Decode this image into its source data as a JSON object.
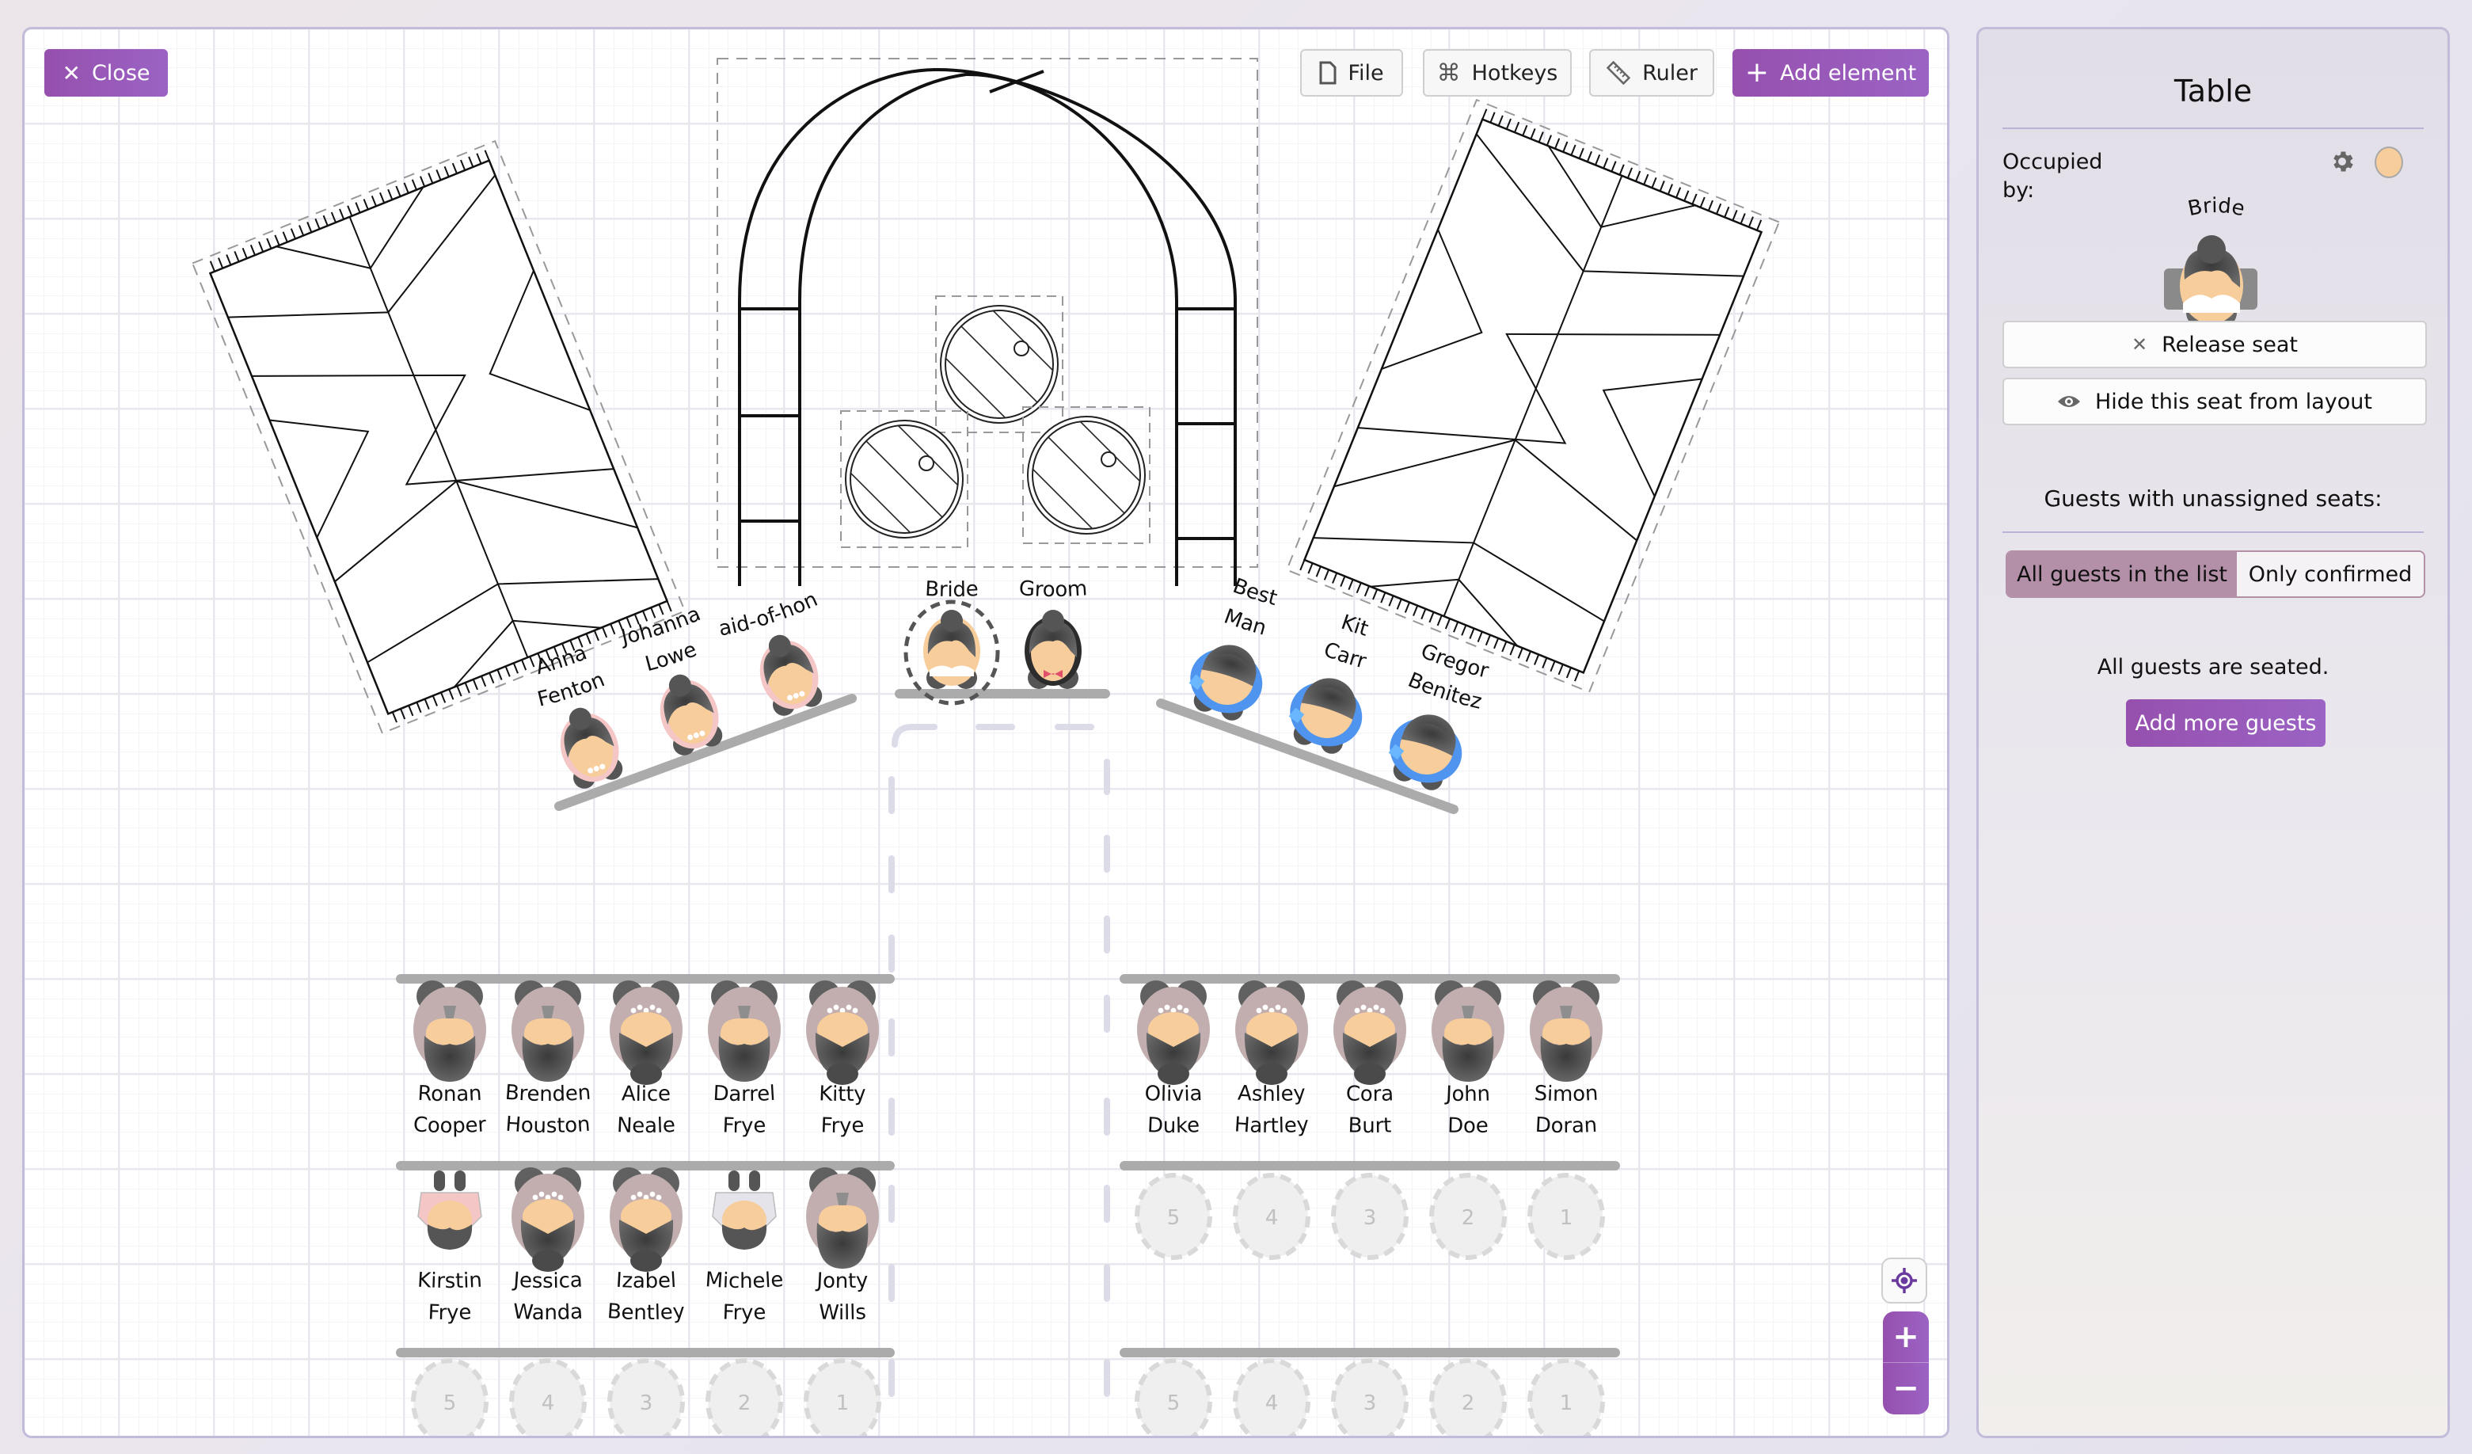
{
  "toolbar": {
    "close_label": "Close",
    "file_label": "File",
    "hotkeys_label": "Hotkeys",
    "ruler_label": "Ruler",
    "add_element_label": "Add element"
  },
  "colors": {
    "accent": "#9650ae",
    "bride_skin": "#f7cd9c",
    "bridesmaid": "#f4c6c6",
    "groomsman": "#4f95f0",
    "guest_body": "#c2aeae",
    "table_bar": "#ababab"
  },
  "layout_elements": {
    "arch": "Arch",
    "barrels": [
      "Barrel",
      "Barrel",
      "Barrel"
    ],
    "rugs": [
      "Rug",
      "Rug"
    ]
  },
  "head_table": {
    "left": [
      {
        "first": "Anna",
        "last": "Fenton",
        "type": "bridesmaid"
      },
      {
        "first": "Johanna",
        "last": "Lowe",
        "type": "bridesmaid"
      },
      {
        "first": "Maid-of-honor",
        "last": "",
        "type": "bridesmaid"
      }
    ],
    "center": [
      {
        "first": "Bride",
        "last": "",
        "type": "bride",
        "selected": true
      },
      {
        "first": "Groom",
        "last": "",
        "type": "groom"
      }
    ],
    "right": [
      {
        "first": "Best",
        "last": "Man",
        "type": "groomsman"
      },
      {
        "first": "Kit",
        "last": "Carr",
        "type": "groomsman"
      },
      {
        "first": "Gregor",
        "last": "Benitez",
        "type": "groomsman"
      }
    ]
  },
  "rows": {
    "left": [
      [
        {
          "first": "Ronan",
          "last": "Cooper",
          "type": "man"
        },
        {
          "first": "Brenden",
          "last": "Houston",
          "type": "man"
        },
        {
          "first": "Alice",
          "last": "Neale",
          "type": "woman"
        },
        {
          "first": "Darrel",
          "last": "Frye",
          "type": "man"
        },
        {
          "first": "Kitty",
          "last": "Frye",
          "type": "woman"
        }
      ],
      [
        {
          "first": "Kirstin",
          "last": "Frye",
          "type": "girl"
        },
        {
          "first": "Jessica",
          "last": "Wanda",
          "type": "woman"
        },
        {
          "first": "Izabel",
          "last": "Bentley",
          "type": "woman"
        },
        {
          "first": "Michele",
          "last": "Frye",
          "type": "boy"
        },
        {
          "first": "Jonty",
          "last": "Wills",
          "type": "man"
        }
      ],
      [
        {
          "empty": "5"
        },
        {
          "empty": "4"
        },
        {
          "empty": "3"
        },
        {
          "empty": "2"
        },
        {
          "empty": "1"
        }
      ]
    ],
    "right": [
      [
        {
          "first": "Olivia",
          "last": "Duke",
          "type": "woman"
        },
        {
          "first": "Ashley",
          "last": "Hartley",
          "type": "woman"
        },
        {
          "first": "Cora",
          "last": "Burt",
          "type": "woman"
        },
        {
          "first": "John",
          "last": "Doe",
          "type": "man"
        },
        {
          "first": "Simon",
          "last": "Doran",
          "type": "man"
        }
      ],
      [
        {
          "empty": "5"
        },
        {
          "empty": "4"
        },
        {
          "empty": "3"
        },
        {
          "empty": "2"
        },
        {
          "empty": "1"
        }
      ],
      [
        {
          "empty": "5"
        },
        {
          "empty": "4"
        },
        {
          "empty": "3"
        },
        {
          "empty": "2"
        },
        {
          "empty": "1"
        }
      ]
    ]
  },
  "sidebar": {
    "title": "Table",
    "occupied_label": "Occupied by:",
    "occupant_name": "Bride",
    "release_label": "Release seat",
    "hide_label": "Hide this seat from layout",
    "unassigned_heading": "Guests with unassigned seats:",
    "filter_options": [
      "All guests in the list",
      "Only confirmed"
    ],
    "filter_selected": "All guests in the list",
    "seated_message": "All guests are seated.",
    "add_guests_label": "Add more guests"
  },
  "zoom_controls": {
    "zoom_in": "+",
    "zoom_out": "−"
  }
}
